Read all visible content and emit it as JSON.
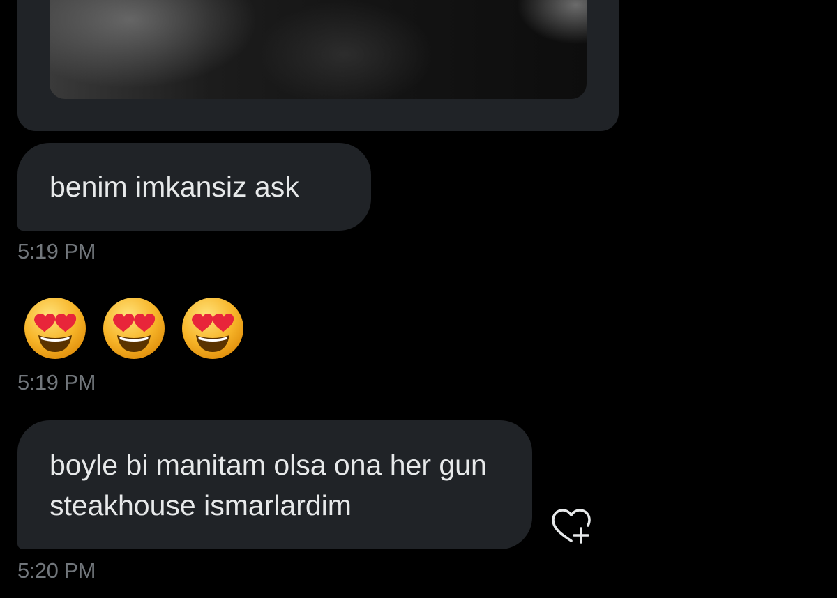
{
  "conversation": {
    "media_message": {
      "image_description": "photo"
    },
    "messages": [
      {
        "text": "benim imkansiz ask",
        "time": "5:19 PM"
      },
      {
        "emojis": [
          "heart-eyes-emoji",
          "heart-eyes-emoji",
          "heart-eyes-emoji"
        ],
        "time": "5:19 PM"
      },
      {
        "text": "boyle bi manitam olsa ona her gun steakhouse ismarlardim",
        "time": "5:20 PM"
      }
    ],
    "react_icon": "heart-plus-icon"
  },
  "colors": {
    "background": "#000000",
    "bubble": "#202327",
    "text": "#e7e9ea",
    "timestamp": "#71767b",
    "emoji_face": "#f7b529",
    "emoji_heart": "#e8253a"
  }
}
